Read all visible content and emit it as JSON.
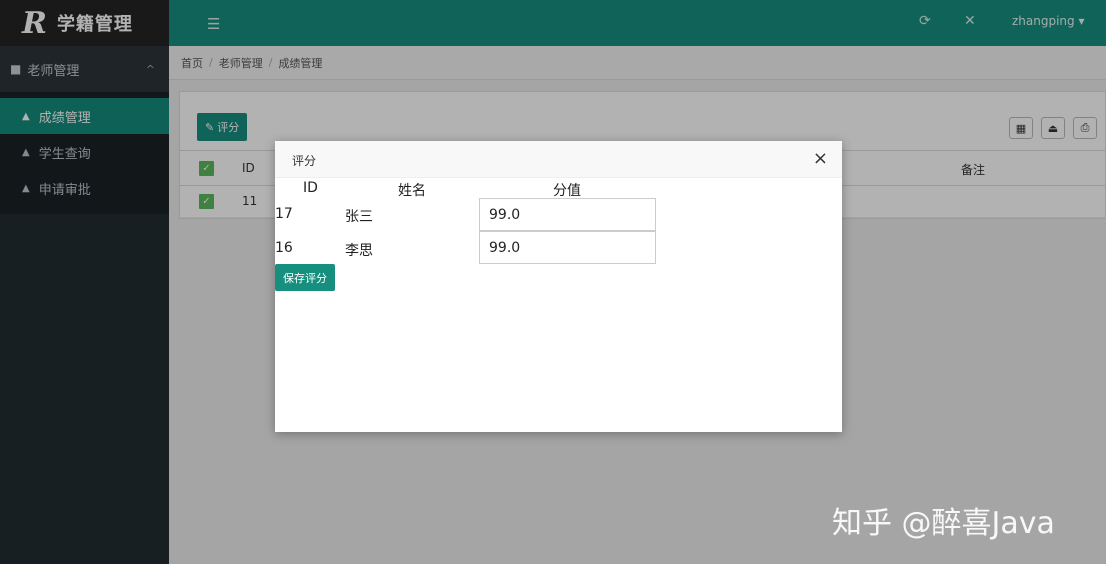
{
  "app": {
    "logo_mark": "R",
    "title": "学籍管理"
  },
  "topbar": {
    "menu_icon": "bars-icon",
    "refresh_icon": "refresh-icon",
    "fullscreen_icon": "expand-icon",
    "user_name": "zhangping",
    "user_caret": "▾"
  },
  "sidebar": {
    "group": {
      "icon": "book-icon",
      "label": "老师管理",
      "chevron": "^"
    },
    "items": [
      {
        "label": "成绩管理",
        "icon": "home-icon",
        "active": true
      },
      {
        "label": "学生查询",
        "icon": "home-icon",
        "active": false
      },
      {
        "label": "申请审批",
        "icon": "home-icon",
        "active": false
      }
    ]
  },
  "breadcrumb": {
    "items": [
      "首页",
      "老师管理",
      "成绩管理"
    ],
    "separator": "/"
  },
  "toolbar": {
    "grade_button": "评分",
    "grade_icon": "pencil-icon",
    "tools": [
      "columns-icon",
      "export-icon",
      "print-icon"
    ]
  },
  "table": {
    "headers": {
      "id": "ID",
      "remark": "备注"
    },
    "rows": [
      {
        "id": "11"
      }
    ]
  },
  "modal": {
    "title": "评分",
    "close": "×",
    "headers": {
      "id": "ID",
      "name": "姓名",
      "score": "分值"
    },
    "rows": [
      {
        "id": "17",
        "name": "张三",
        "score": "99.0"
      },
      {
        "id": "16",
        "name": "李思",
        "score": "99.0"
      }
    ],
    "save_button": "保存评分"
  },
  "watermark": "知乎 @醉喜Java",
  "colors": {
    "brand": "#178f7f",
    "sidebar": "#222d32",
    "checkbox": "#5cb85c"
  }
}
